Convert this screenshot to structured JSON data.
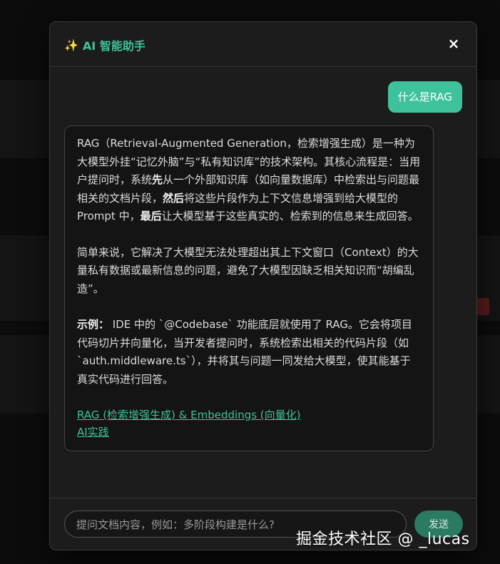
{
  "modal": {
    "title_icon": "✨",
    "title": "AI 智能助手",
    "close_label": "×"
  },
  "chat": {
    "user_message": "什么是RAG",
    "ai_message": {
      "p1_a": "RAG（Retrieval-Augmented Generation，检索增强生成）是一种为大模型外挂“记忆外脑”与“私有知识库”的技术架构。其核心流程是：当用户提问时，系统",
      "p1_b1": "先",
      "p1_c": "从一个外部知识库（如向量数据库）中检索出与问题最相关的文档片段，",
      "p1_b2": "然后",
      "p1_d": "将这些片段作为上下文信息增强到给大模型的 Prompt 中，",
      "p1_b3": "最后",
      "p1_e": "让大模型基于这些真实的、检索到的信息来生成回答。",
      "p2": "简单来说，它解决了大模型无法处理超出其上下文窗口（Context）的大量私有数据或最新信息的问题，避免了大模型因缺乏相关知识而“胡编乱造”。",
      "p3_label": "示例：",
      "p3": " IDE 中的 `@Codebase` 功能底层就使用了 RAG。它会将项目代码切片并向量化，当开发者提问时，系统检索出相关的代码片段（如 `auth.middleware.ts`），并将其与问题一同发给大模型，使其能基于真实代码进行回答。",
      "links": [
        "RAG (检索增强生成) & Embeddings (向量化)",
        "AI实践"
      ]
    }
  },
  "footer": {
    "input_placeholder": "提问文档内容，例如：多阶段构建是什么?",
    "send_label": "发送"
  },
  "watermark": "掘金技术社区 @ _lucas",
  "colors": {
    "accent": "#3ec29b",
    "background": "#1c1c1c"
  }
}
